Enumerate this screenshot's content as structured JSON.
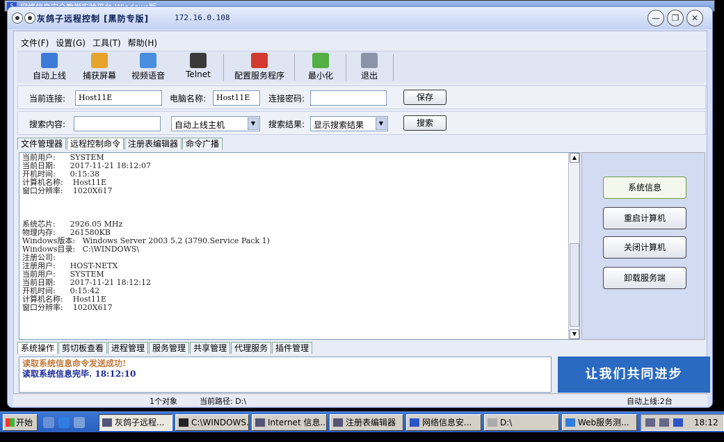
{
  "outer_title": "网络信息安全教学实验平台-Windows版",
  "window": {
    "title": "灰鸽子远程控制 [黑防专版]",
    "ip": "172.16.0.108",
    "min": "—",
    "max": "❐",
    "close": "✕"
  },
  "menu": [
    "文件(F)",
    "设置(G)",
    "工具(T)",
    "帮助(H)"
  ],
  "toolbar": [
    {
      "label": "自动上线",
      "icon": "auto-online-icon",
      "color": "#3c7ad8"
    },
    {
      "label": "捕获屏幕",
      "icon": "capture-screen-icon",
      "color": "#e6a42b"
    },
    {
      "label": "视频语音",
      "icon": "video-voice-icon",
      "color": "#4a8ee0"
    },
    {
      "label": "Telnet",
      "icon": "telnet-icon",
      "color": "#3a3a3a"
    },
    {
      "label": "配置服务程序",
      "icon": "config-service-icon",
      "color": "#d23a2f"
    },
    {
      "label": "最小化",
      "icon": "minimize-icon",
      "color": "#52b043"
    },
    {
      "label": "退出",
      "icon": "exit-icon",
      "color": "#8a93a8"
    }
  ],
  "connection": {
    "current_label": "当前连接:",
    "current_value": "Host11E",
    "pc_label": "电脑名称:",
    "pc_value": "Host11E",
    "pwd_label": "连接密码:",
    "pwd_value": "",
    "save": "保存"
  },
  "search": {
    "content_label": "搜索内容:",
    "content_value": "",
    "type_value": "自动上线主机",
    "result_label": "搜索结果:",
    "result_value": "显示搜索结果",
    "button": "搜索"
  },
  "top_tabs": [
    "文件管理器",
    "远程控制命令",
    "注册表编辑器",
    "命令广播"
  ],
  "log_text": "当前用户:      SYSTEM\n当前日期:      2017-11-21 18:12:07\n开机时间:      0:15:38\n计算机名称:    Host11E\n窗口分辨率:    1020X617\n\n\n\n系统芯片:      2926.05 MHz\n物理内存:      261580KB\nWindows版本:   Windows Server 2003 5.2 (3790.Service Pack 1)\nWindows目录:   C:\\WINDOWS\\\n注册公司:\n注册用户:      HOST-NETX\n当前用户:      SYSTEM\n当前日期:      2017-11-21 18:12:12\n开机时间:      0:15:42\n计算机名称:    Host11E\n窗口分辨率:    1020X617",
  "right_buttons": [
    "系统信息",
    "重启计算机",
    "关闭计算机",
    "卸载服务端"
  ],
  "bottom_tabs": [
    "系统操作",
    "剪切板查看",
    "进程管理",
    "服务管理",
    "共享管理",
    "代理服务",
    "插件管理"
  ],
  "status_lines": [
    {
      "text": "读取系统信息命令发送成功!",
      "color": "#c5793a"
    },
    {
      "text": "读取系统信息完毕. 18:12:10",
      "color": "#1a2a9a"
    }
  ],
  "banner": "让我们共同进步",
  "statusbar": {
    "objects": "1个对象",
    "path": "当前路径: D:\\",
    "online": "自动上线:2台"
  },
  "taskbar": {
    "start": "开始",
    "items": [
      "灰鸽子远程...",
      "C:\\WINDOWS...",
      "Internet 信息...",
      "注册表编辑器",
      "网络信息安...",
      "D:\\",
      "Web服务测..."
    ],
    "clock": "18:12"
  }
}
